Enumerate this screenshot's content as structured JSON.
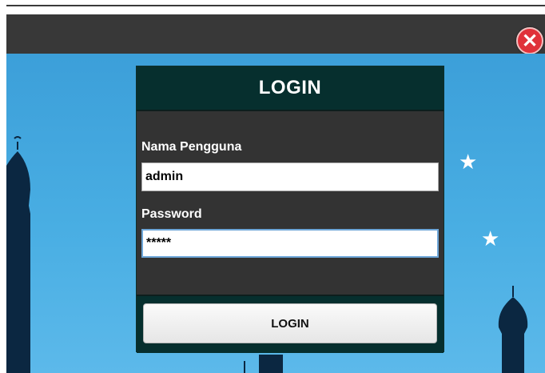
{
  "window": {
    "close_glyph": "✕",
    "close_icon": "close-icon",
    "close_color": "#e0313a"
  },
  "login": {
    "title": "LOGIN",
    "username_label": "Nama Pengguna",
    "username_value": "admin",
    "password_label": "Password",
    "password_value": "*****",
    "submit_label": "LOGIN"
  },
  "background": {
    "stars": [
      "★",
      "★"
    ],
    "sky_color": "#49aee3",
    "silhouette_color": "#0b2741"
  },
  "colors": {
    "panel": "#333333",
    "header": "#062f2e",
    "titlebar": "#383838"
  }
}
